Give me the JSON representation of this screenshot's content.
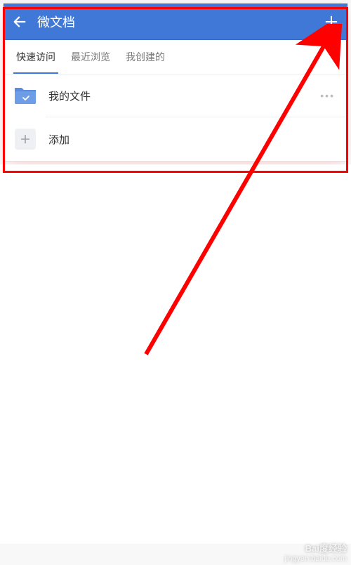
{
  "header": {
    "title": "微文档"
  },
  "tabs": {
    "items": [
      {
        "label": "快速访问"
      },
      {
        "label": "最近浏览"
      },
      {
        "label": "我创建的"
      }
    ],
    "active_index": 0
  },
  "list": {
    "folder_row": {
      "label": "我的文件"
    },
    "add_row": {
      "label": "添加"
    }
  },
  "colors": {
    "brand": "#3f78d6",
    "annotation": "#ff0000"
  },
  "watermark": {
    "brand": "Bai度经验",
    "url": "jingyan.baidu.com"
  }
}
